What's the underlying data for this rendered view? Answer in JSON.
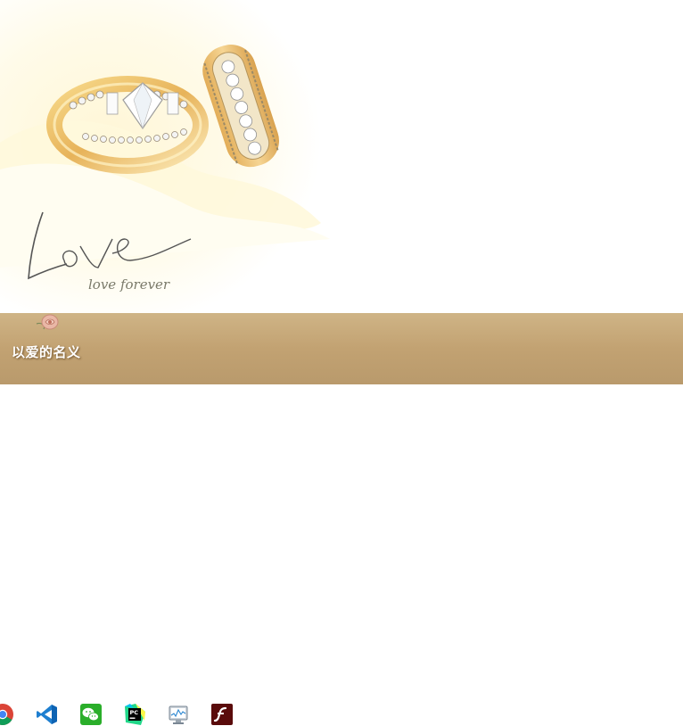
{
  "hero": {
    "script_text": "Love",
    "sub_text": "love forever"
  },
  "banner": {
    "title": "以爱的名义",
    "color_top": "#cfb486",
    "color_bottom": "#b99a6c"
  },
  "taskbar": {
    "items": [
      {
        "icon": "chrome-icon"
      },
      {
        "icon": "vscode-icon"
      },
      {
        "icon": "wechat-icon"
      },
      {
        "icon": "pycharm-icon"
      },
      {
        "icon": "resource-monitor-icon"
      },
      {
        "icon": "flash-icon"
      }
    ]
  }
}
